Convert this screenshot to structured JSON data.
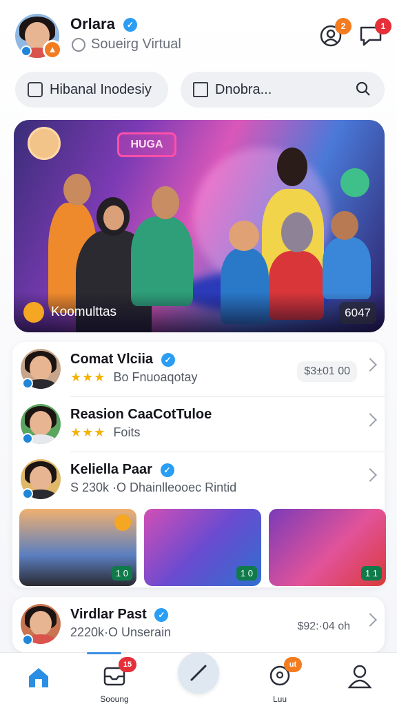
{
  "header": {
    "name": "Orlara",
    "subtitle": "Soueirg Virtual",
    "badge_counts": {
      "friends": "2",
      "notifications": "1"
    }
  },
  "search": {
    "left_label": "Hibanal Inodesiy",
    "right_label": "Dnobra..."
  },
  "hero": {
    "sign_text": "HUGA",
    "label": "Koomulttas",
    "count": "6047"
  },
  "list": {
    "items": [
      {
        "title": "Comat Vlciia",
        "stars": "★★★",
        "subtitle": "Bo Fnuoaqotay",
        "price": "$3±01 00"
      },
      {
        "title": "Reasion CaaCotTuloe",
        "stars": "★★★",
        "subtitle": "Foits",
        "price": ""
      },
      {
        "title": "Keliella Paar",
        "stars": "",
        "subtitle": "S 230k ·O Dhainlleooec Rintid",
        "price": ""
      }
    ],
    "thumbs": [
      {
        "badge": "1 0"
      },
      {
        "badge": "1 0"
      },
      {
        "badge": "1 1"
      }
    ]
  },
  "bottom_item": {
    "title": "Virdlar Past",
    "subtitle": "2220k·O Unserain",
    "price": "$92:·04 oh"
  },
  "nav": {
    "items": [
      {
        "label": "",
        "icon": "home-icon",
        "badge": ""
      },
      {
        "label": "Sooung",
        "icon": "inbox-icon",
        "badge": "15"
      },
      {
        "label": "",
        "icon": "compose-icon",
        "badge": ""
      },
      {
        "label": "Luu",
        "icon": "chat-icon",
        "badge": "ut"
      },
      {
        "label": "",
        "icon": "profile-icon",
        "badge": ""
      }
    ]
  },
  "colors": {
    "accent": "#2a9df4",
    "badge_orange": "#f47c20",
    "badge_red": "#e5303a",
    "rating": "#f5b300"
  }
}
